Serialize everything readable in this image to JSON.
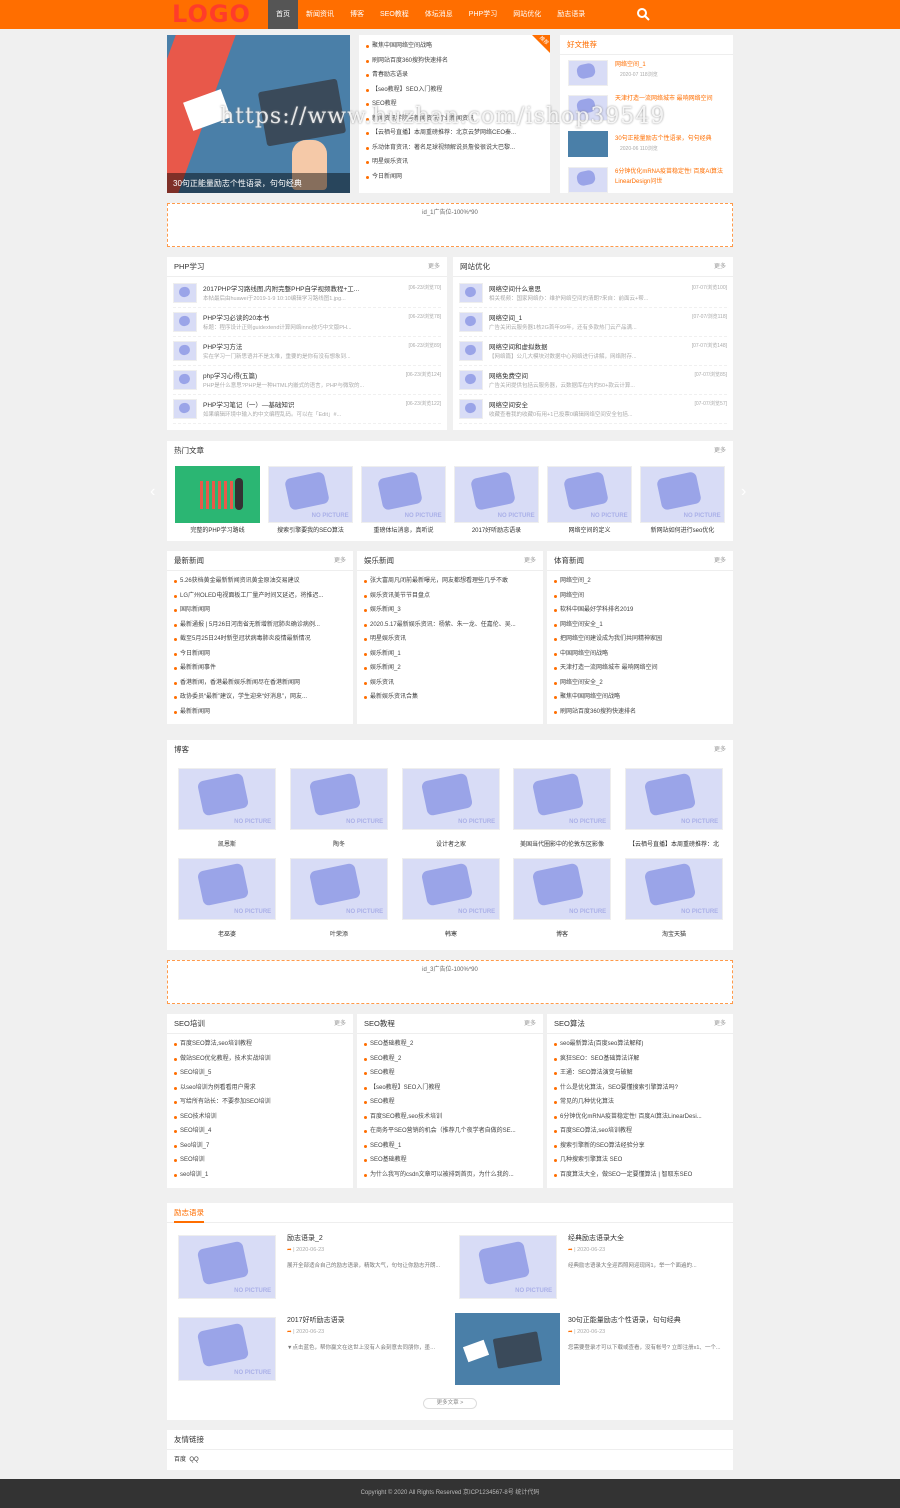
{
  "header": {
    "logo": "LOGO",
    "nav": [
      "首页",
      "新闻资讯",
      "博客",
      "SEO教程",
      "体坛消息",
      "PHP学习",
      "网站优化",
      "励志语录"
    ],
    "search_icon": "search-icon",
    "accent": "#ff6e00"
  },
  "banner": {
    "caption": "30句正能量励志个性语录，句句经典",
    "watermark": "https://www.huzhan.com/ishop39549"
  },
  "toplist": {
    "badge": "推荐",
    "items": [
      "聚焦中国网络空间战略",
      "刷网站百度360搜狗快速排名",
      "青春励志语录",
      "【seo教程】SEO入门教程",
      "SEO教程",
      "新闻资讯学院与新闻资讯行业新闻资讯",
      "【云栖号直播】本周重磅推荐：北京云梦网络CEO秦...",
      "乐动体育资讯：著名足球视频解说员詹俊很说大巴黎...",
      "明星娱乐资讯",
      "今日新闻网"
    ]
  },
  "haowen": {
    "title": "好文推荐",
    "items": [
      {
        "t": "网络空间_1",
        "m": "2020-07  118浏览"
      },
      {
        "t": "天津打造一流网络城市 最响网络空间",
        "m": ""
      },
      {
        "t": "30句正能量励志个性语录，句句经典",
        "m": "2020-06  110浏览"
      },
      {
        "t": "6分钟优化mRNA疫苗稳定性! 百度AI算法LinearDesign问世",
        "m": ""
      }
    ]
  },
  "ad1": "id_1广告位-100%*90",
  "ad3": "id_3广告位-100%*90",
  "more": "更多",
  "php": {
    "title": "PHP学习",
    "items": [
      {
        "t": "2017PHP学习路线图,内附完整PHP自学视频教程+工...",
        "d": "本帖最后由huawei于2019-1-9 10:10编辑学习路线图1.jpg...",
        "dt": "[06-23/浏览70]"
      },
      {
        "t": "PHP学习必读的20本书",
        "d": "标题：程序设计正则guidextend计算网络inno技巧中文版PH...",
        "dt": "[06-23/浏览78]"
      },
      {
        "t": "PHP学习方法",
        "d": "实在学习一门新思语并不是太难，重要的是你有没有想象到...",
        "dt": "[06-23/浏览89]"
      },
      {
        "t": "php学习心得(五篇)",
        "d": "PHP是什么意思?PHP是一种HTML内嵌式的语言，PHP与微软的...",
        "dt": "[06-23/浏览124]"
      },
      {
        "t": "PHP学习笔记（一）—基础知识",
        "d": "如果编辑环境中输入的中文编程乱码。可以在「Edit」#...",
        "dt": "[06-23/浏览122]"
      }
    ]
  },
  "seo": {
    "title": "网站优化",
    "items": [
      {
        "t": "网络空间什么意思",
        "d": "相关视频：国家网络办：维护网络空间的清朗?来自：前面云+帮...",
        "dt": "[07-07/浏览100]"
      },
      {
        "t": "网络空间_1",
        "d": "广告关闭云服务器1核2G首年99年，还有多款热门云产品满...",
        "dt": "[07-07/浏览118]"
      },
      {
        "t": "网络空间和虚拟数据",
        "d": "【网络篇】公几大模块对数据中心网络进行讲解，网络附存...",
        "dt": "[07-07/浏览148]"
      },
      {
        "t": "网络免费空间",
        "d": "广告关闭提供包括云服务器，云数据库在内的50+款云计算...",
        "dt": "[07-07/浏览85]"
      },
      {
        "t": "网络空间安全",
        "d": "收藏查看我的收藏0有用+1已投票0编辑网络空间安全包括...",
        "dt": "[07-07/浏览57]"
      }
    ]
  },
  "hot": {
    "title": "热门文章",
    "items": [
      "完整的PHP学习路线",
      "搜索引擎要我的SEO算法",
      "重磅体坛消息，真听说",
      "2017好听励志语录",
      "网络空间的定义",
      "新网站如何进行seo优化"
    ]
  },
  "news": {
    "title": "最新新闻",
    "items": [
      "5.26获档黄金最新新闻资讯黄金原油交易建议",
      "LG广州OLED电视面板工厂量产时间又延迟，将推迟...",
      "国际新闻网",
      "最新通报 | 5月26日河南省无新增新冠肺炎确诊病例...",
      "截至5月25日24时新型冠状病毒肺炎疫情最新情况",
      "今日新闻网",
      "最新新闻事件",
      "香港新闻，香港最新娱乐新闻尽在香港新闻网",
      "政协委员“最新”建议，学生迎来“好消息”，网友...",
      "最新新闻网"
    ]
  },
  "ent": {
    "title": "娱乐新闻",
    "items": [
      "张大富周凡闭前最新曝光，网友都想看理些几乎不敢",
      "娱乐资讯美节节目盘点",
      "娱乐新闻_3",
      "2020.5.17最新娱乐资讯：杨紫、朱一龙、任嘉伦、吴...",
      "明星娱乐资讯",
      "娱乐新闻_1",
      "娱乐新闻_2",
      "娱乐资讯",
      "最新娱乐资讯合集"
    ]
  },
  "sport": {
    "title": "体育新闻",
    "items": [
      "网络空间_2",
      "网络空间",
      "软科中国最好学科排名2019",
      "网络空间安全_1",
      "把网络空间建设成为我们共同精神家园",
      "中国网络空间战略",
      "天津打造一流网络城市 最响网络空间",
      "网络空间安全_2",
      "聚焦中国网络空间战略",
      "刷网站百度360搜狗快速排名"
    ]
  },
  "blog": {
    "title": "博客",
    "items": [
      "凯恩斯",
      "陶冬",
      "设计者之家",
      "美国当代圈影中的伦敦东区影像",
      "【云栖号直播】本周重磅推荐：北",
      "老巫婆",
      "叶荣添",
      "韩寒",
      "博客",
      "淘宝天猫"
    ]
  },
  "seotrain": {
    "title": "SEO培训",
    "items": [
      "百度SEO算法,seo培训教程",
      "做站SEO优化教程，技术实战培训",
      "SEO培训_5",
      "以seo培训为例看看用户需求",
      "写给所有站长：不要参加SEO培训",
      "SEO技术培训",
      "SEO培训_4",
      "Seo培训_7",
      "SEO培训",
      "seo培训_1"
    ]
  },
  "seotut": {
    "title": "SEO教程",
    "items": [
      "SEO基础教程_2",
      "SEO教程_2",
      "SEO教程",
      "【seo教程】SEO入门教程",
      "SEO教程",
      "百度SEO教程,seo技术培训",
      "在商务平SEO营销的机会（推荐几个夜学者自做的SE...",
      "SEO教程_1",
      "SEO基础教程",
      "为什么我写的csdn文章可以被排到首页，为什么我的..."
    ]
  },
  "seoalgo": {
    "title": "SEO算法",
    "items": [
      "seo最新算法(百度seo算法解释)",
      "疯狂SEO：SEO基础算法详解",
      "王通：SEO算法演变与破解",
      "什么是优化算法，SEO要懂搜索引擎算法吗?",
      "常见的几种优化算法",
      "6分钟优化mRNA疫苗稳定性! 百度AI算法LinearDesi...",
      "百度SEO算法,seo培训教程",
      "搜索引擎新的SEO算法经验分享",
      "几种搜索引擎算法 SEO",
      "百度算法大全，做SEO一定要懂算法 | 智取东SEO"
    ]
  },
  "quotes": {
    "title": "励志语录",
    "items": [
      {
        "t": "励志语录_2",
        "dt": "| 2020-06-23",
        "d": "展开全部适合自己的励志语录，精致大气，句句让你励志开朗..."
      },
      {
        "t": "经典励志语录大全",
        "dt": "| 2020-06-23",
        "d": "经典励志语录大全迎西照网迎现网1，举一个面遍的..."
      },
      {
        "t": "2017好听励志语录",
        "dt": "| 2020-06-23",
        "d": "▼点击蓝色，帮你赢文在这世上没有人会刻意去同朋你，墨…"
      },
      {
        "t": "30句正能量励志个性语录，句句经典",
        "dt": "| 2020-06-23",
        "d": "您需要登录才可以下载或查看，没有帐号? 立即注册x1、一个..."
      }
    ],
    "more": "更多文章 >"
  },
  "links": {
    "title": "友情链接",
    "items": [
      "百度",
      "QQ"
    ]
  },
  "footer": "Copyright © 2020 All Rights Reserved 京ICP1234567-8号 统计代码"
}
